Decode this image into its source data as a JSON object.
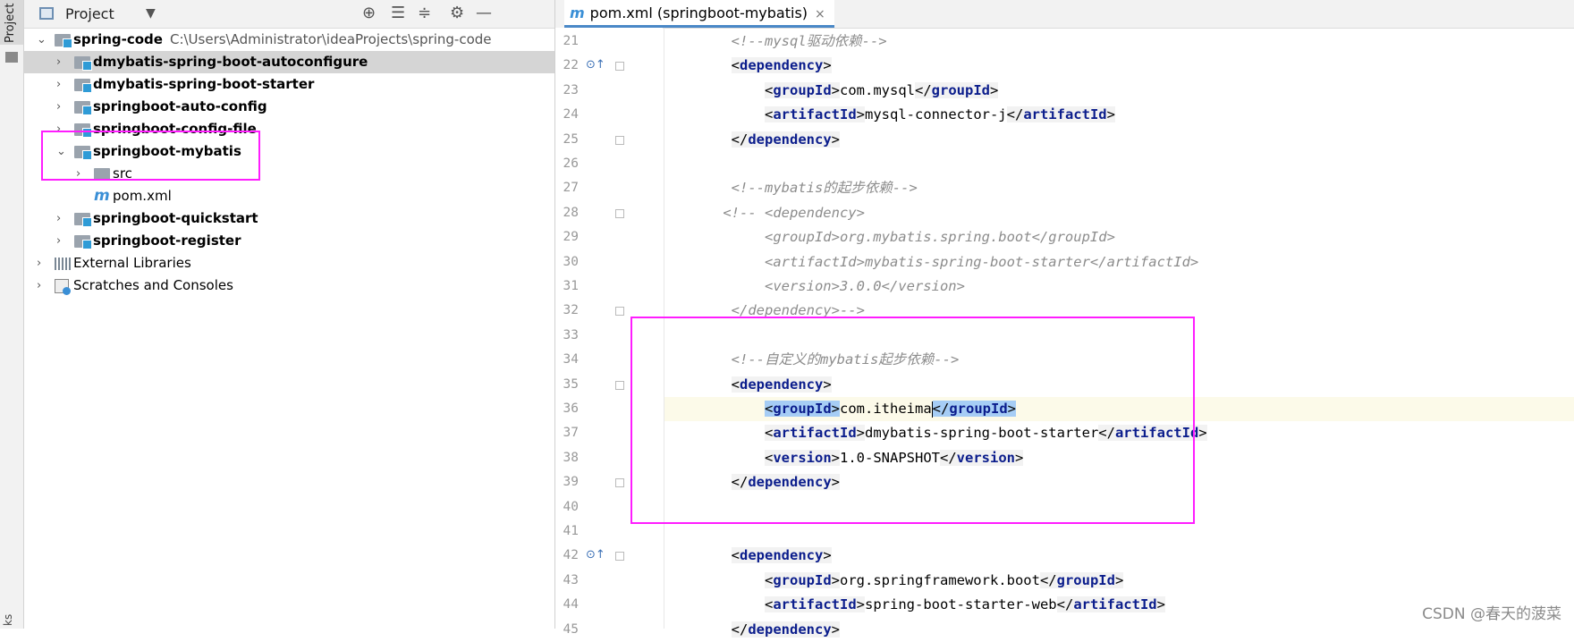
{
  "tool_strip": {
    "project_tab": "Project",
    "bottom_tab": "ks"
  },
  "project_panel": {
    "title": "Project",
    "tree": [
      {
        "label": "spring-code",
        "path": "C:\\Users\\Administrator\\ideaProjects\\spring-code",
        "bold": true,
        "icon": "module-folder-icon",
        "arrow": "expanded"
      },
      {
        "label": "dmybatis-spring-boot-autoconfigure",
        "bold": true,
        "icon": "module-folder-icon",
        "arrow": "collapsed",
        "selected": true
      },
      {
        "label": "dmybatis-spring-boot-starter",
        "bold": true,
        "icon": "module-folder-icon",
        "arrow": "collapsed"
      },
      {
        "label": "springboot-auto-config",
        "bold": true,
        "icon": "module-folder-icon",
        "arrow": "collapsed"
      },
      {
        "label": "springboot-config-file",
        "bold": true,
        "icon": "module-folder-icon",
        "arrow": "collapsed"
      },
      {
        "label": "springboot-mybatis",
        "bold": true,
        "icon": "module-folder-icon",
        "arrow": "expanded"
      },
      {
        "label": "src",
        "bold": false,
        "icon": "folder-icon",
        "arrow": "collapsed"
      },
      {
        "label": "pom.xml",
        "bold": false,
        "icon": "maven-icon",
        "arrow": "none"
      },
      {
        "label": "springboot-quickstart",
        "bold": true,
        "icon": "module-folder-icon",
        "arrow": "collapsed"
      },
      {
        "label": "springboot-register",
        "bold": true,
        "icon": "module-folder-icon",
        "arrow": "collapsed"
      },
      {
        "label": "External Libraries",
        "bold": false,
        "icon": "library-icon",
        "arrow": "collapsed"
      },
      {
        "label": "Scratches and Consoles",
        "bold": false,
        "icon": "scratch-icon",
        "arrow": "collapsed"
      }
    ]
  },
  "editor": {
    "tab_icon": "m",
    "tab_label": "pom.xml (springboot-mybatis)",
    "tab_close": "×",
    "lines": [
      {
        "no": "21",
        "text": "        <!--mysql驱动依赖-->"
      },
      {
        "no": "22",
        "text": "        <dependency>"
      },
      {
        "no": "23",
        "text": "            <groupId>com.mysql</groupId>"
      },
      {
        "no": "24",
        "text": "            <artifactId>mysql-connector-j</artifactId>"
      },
      {
        "no": "25",
        "text": "        </dependency>"
      },
      {
        "no": "26",
        "text": ""
      },
      {
        "no": "27",
        "text": "        <!--mybatis的起步依赖-->"
      },
      {
        "no": "28",
        "text": "       <!-- <dependency>"
      },
      {
        "no": "29",
        "text": "            <groupId>org.mybatis.spring.boot</groupId>"
      },
      {
        "no": "30",
        "text": "            <artifactId>mybatis-spring-boot-starter</artifactId>"
      },
      {
        "no": "31",
        "text": "            <version>3.0.0</version>"
      },
      {
        "no": "32",
        "text": "        </dependency>-->"
      },
      {
        "no": "33",
        "text": ""
      },
      {
        "no": "34",
        "text": "        <!--自定义的mybatis起步依赖-->"
      },
      {
        "no": "35",
        "text": "        <dependency>"
      },
      {
        "no": "36",
        "text": "            <groupId>com.itheima</groupId>"
      },
      {
        "no": "37",
        "text": "            <artifactId>dmybatis-spring-boot-starter</artifactId>"
      },
      {
        "no": "38",
        "text": "            <version>1.0-SNAPSHOT</version>"
      },
      {
        "no": "39",
        "text": "        </dependency>"
      },
      {
        "no": "40",
        "text": ""
      },
      {
        "no": "41",
        "text": ""
      },
      {
        "no": "42",
        "text": "        <dependency>"
      },
      {
        "no": "43",
        "text": "            <groupId>org.springframework.boot</groupId>"
      },
      {
        "no": "44",
        "text": "            <artifactId>spring-boot-starter-web</artifactId>"
      },
      {
        "no": "45",
        "text": "        </dependency>"
      }
    ]
  },
  "watermark": "CSDN @春天的菠菜",
  "colors": {
    "highlight_box": "#ff1dff",
    "tag": "#0b1d8c",
    "comment": "#8c8c8c",
    "selection": "#a6cdf5"
  }
}
